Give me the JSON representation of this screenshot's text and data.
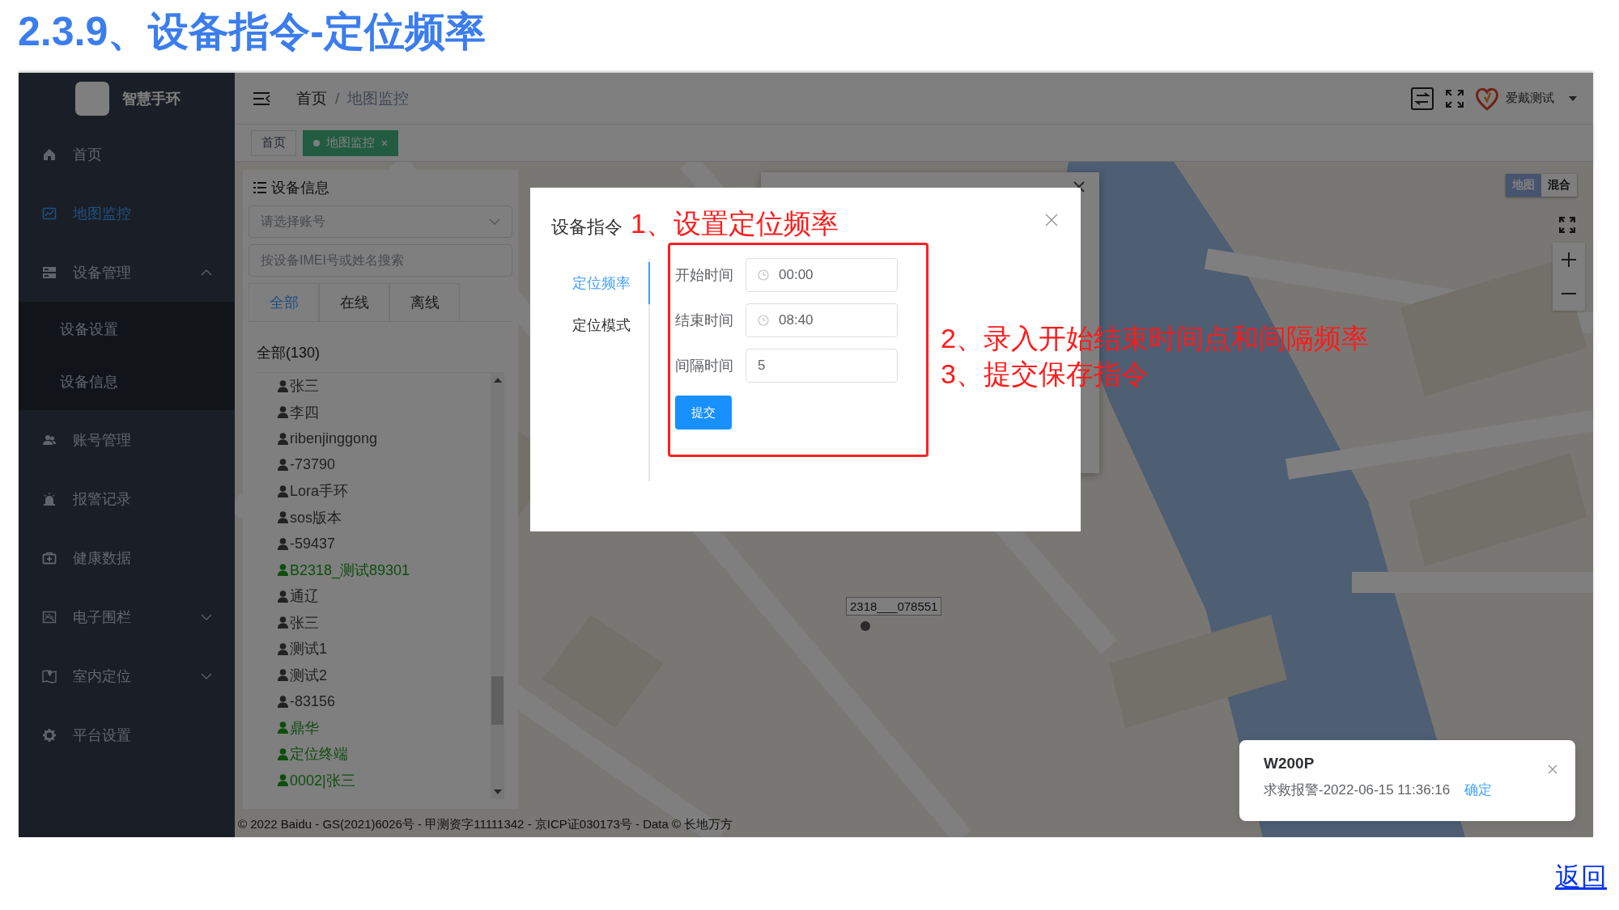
{
  "doc_title": "2.3.9、设备指令-定位频率",
  "app": {
    "sidebar": {
      "logo_text": "智慧手环",
      "items": [
        {
          "label": "首页",
          "selected": false
        },
        {
          "label": "地图监控",
          "selected": true
        },
        {
          "label": "设备管理",
          "selected": false,
          "expanded": true,
          "children": [
            {
              "label": "设备设置",
              "selected": false
            },
            {
              "label": "设备信息",
              "selected": false
            }
          ]
        },
        {
          "label": "账号管理",
          "selected": false
        },
        {
          "label": "报警记录",
          "selected": false
        },
        {
          "label": "健康数据",
          "selected": false
        },
        {
          "label": "电子围栏",
          "selected": false,
          "expanded": false
        },
        {
          "label": "室内定位",
          "selected": false,
          "expanded": false
        },
        {
          "label": "平台设置",
          "selected": false
        }
      ]
    },
    "header": {
      "breadcrumb": [
        "首页",
        "地图监控"
      ],
      "breadcrumb_separator": "/",
      "user": "爱戴测试"
    },
    "tags": [
      {
        "label": "首页",
        "selected": false
      },
      {
        "label": "地图监控",
        "selected": true
      }
    ],
    "device_panel": {
      "title": "设备信息",
      "account_select": {
        "placeholder": "请选择账号"
      },
      "search": {
        "placeholder": "按设备IMEI号或姓名搜索"
      },
      "tabs": [
        {
          "label": "全部",
          "selected": true
        },
        {
          "label": "在线",
          "selected": false
        },
        {
          "label": "离线",
          "selected": false
        }
      ],
      "tree": {
        "label": "全部(130)",
        "children": [
          {
            "label": "张三",
            "online": false
          },
          {
            "label": "李四",
            "online": false
          },
          {
            "label": "ribenjinggong",
            "online": false
          },
          {
            "label": "-73790",
            "online": false
          },
          {
            "label": "Lora手环",
            "online": false
          },
          {
            "label": "sos版本",
            "online": false
          },
          {
            "label": "-59437",
            "online": false
          },
          {
            "label": "B2318_测试89301",
            "online": true
          },
          {
            "label": "通辽",
            "online": false
          },
          {
            "label": "张三",
            "online": false
          },
          {
            "label": "测试1",
            "online": false
          },
          {
            "label": "测试2",
            "online": false
          },
          {
            "label": "-83156",
            "online": false
          },
          {
            "label": "鼎华",
            "online": true
          },
          {
            "label": "定位终端",
            "online": true
          },
          {
            "label": "0002|张三",
            "online": true
          }
        ]
      }
    },
    "map": {
      "marker_label": "2318___078551",
      "map_types": [
        {
          "label": "地图",
          "selected": true
        },
        {
          "label": "混合",
          "selected": false
        }
      ],
      "copyright": "© 2022 Baidu - GS(2021)6026号 - 甲测资字11111342 - 京ICP证030173号 - Data © 长地万方"
    },
    "dialog": {
      "title": "设备指令",
      "title_annotation": "1、设置定位频率",
      "tabs": [
        {
          "label": "定位频率",
          "selected": true
        },
        {
          "label": "定位模式",
          "selected": false
        }
      ],
      "fields": [
        {
          "label": "开始时间",
          "value": "00:00",
          "kind": "time"
        },
        {
          "label": "结束时间",
          "value": "08:40",
          "kind": "time"
        },
        {
          "label": "间隔时间",
          "value": "5",
          "kind": "text"
        }
      ],
      "submit": "提交",
      "side_annotations": [
        "2、录入开始结束时间点和间隔频率",
        "3、提交保存指令"
      ]
    },
    "notification": {
      "title": "W200P",
      "message": "求救报警-2022-06-15 11:36:16",
      "action": "确定"
    }
  },
  "back_link": "返回"
}
